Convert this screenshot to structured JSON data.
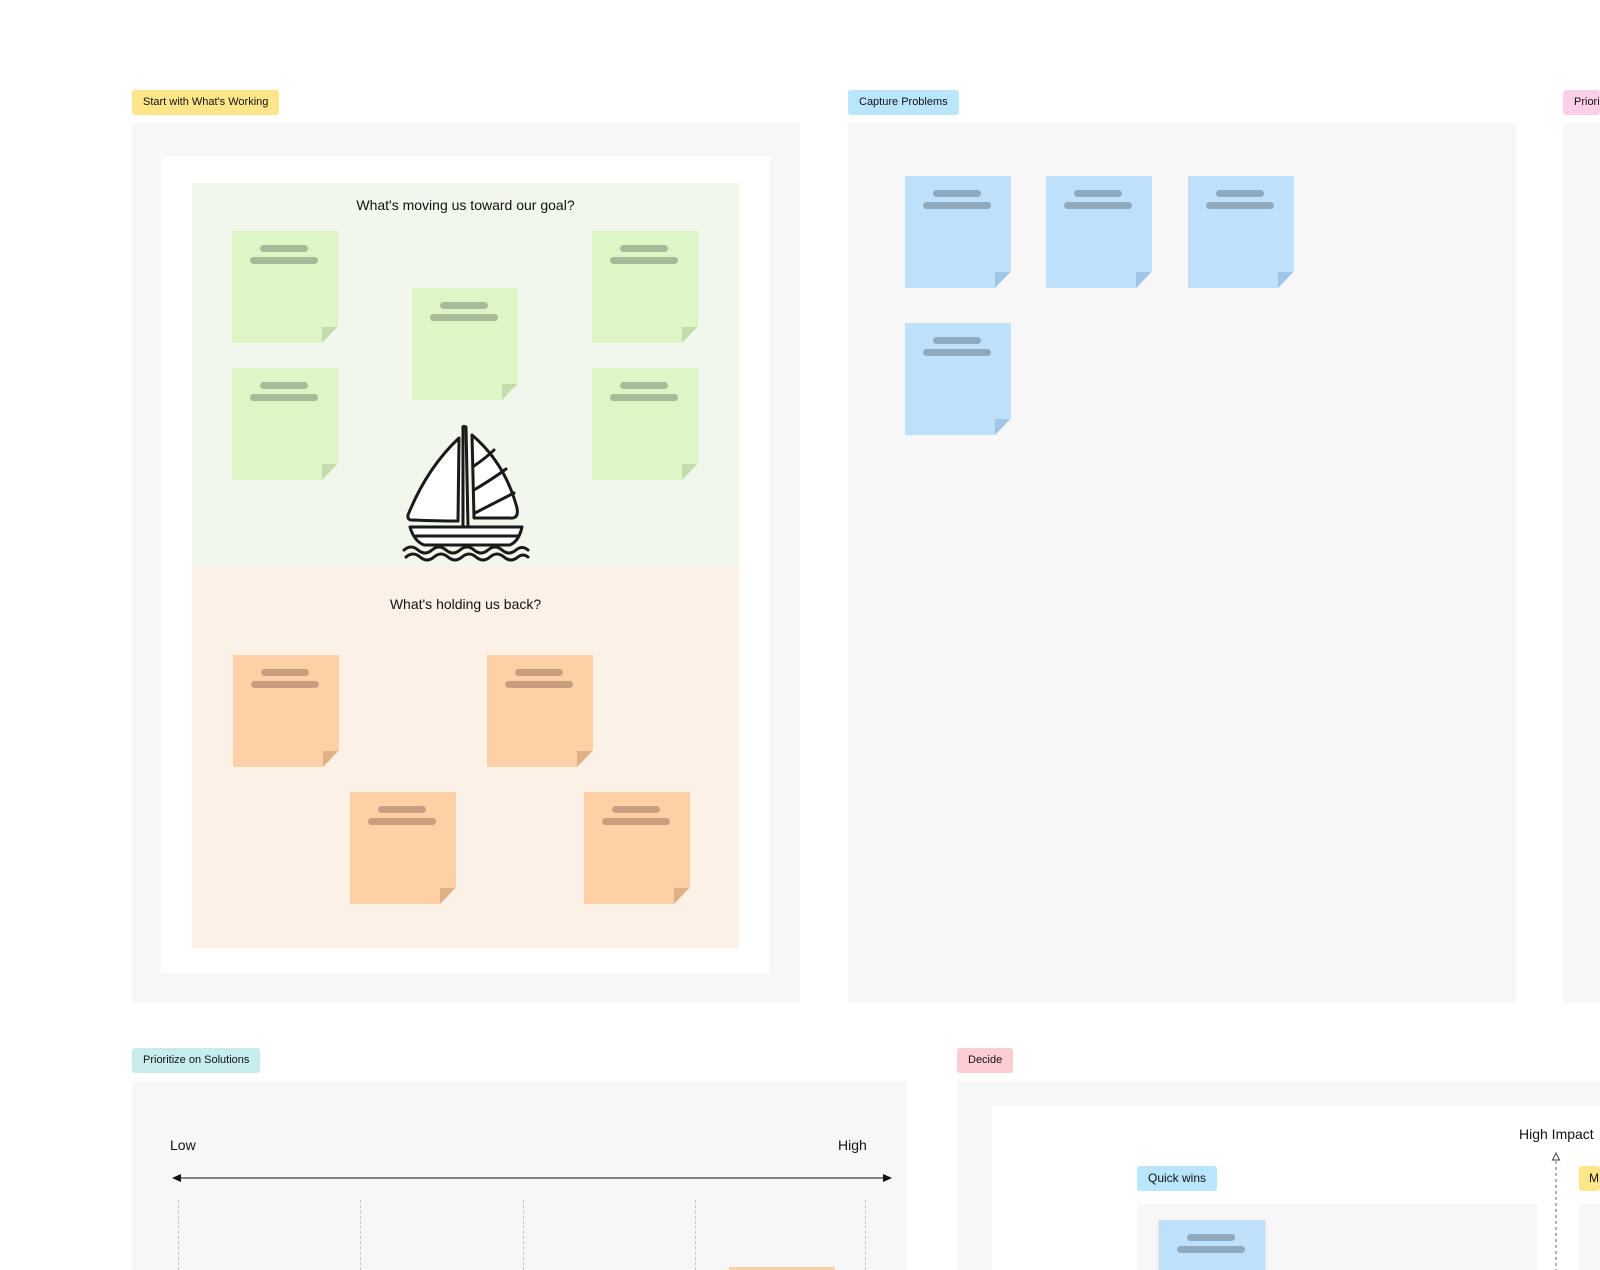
{
  "sections": {
    "working": {
      "tag": "Start with What's Working",
      "tag_color": "#fde68a",
      "top_zone": {
        "title": "What's moving us toward our goal?",
        "color": "#f1f7ea"
      },
      "bottom_zone": {
        "title": "What's holding us back?",
        "color": "#fcf1e7"
      },
      "illustration": "sailboat-illustration"
    },
    "problems": {
      "tag": "Capture Problems",
      "tag_color": "#bae6fd"
    },
    "third": {
      "tag": "Priori",
      "tag_color": "#fbcfe8"
    },
    "solutions": {
      "tag": "Prioritize on Solutions",
      "tag_color": "#c6ecec",
      "scale_low": "Low",
      "scale_high": "High"
    },
    "decide": {
      "tag": "Decide",
      "tag_color": "#fecdd3",
      "y_axis_label": "High Impact",
      "quadrant_tag": "Quick wins",
      "quadrant_tag_color": "#bae6fd",
      "second_tag": "M",
      "second_tag_color": "#fde68a"
    }
  },
  "sticky_colors": {
    "green": "#def5c6",
    "orange": "#fdd0a6",
    "blue": "#bee0fb"
  }
}
